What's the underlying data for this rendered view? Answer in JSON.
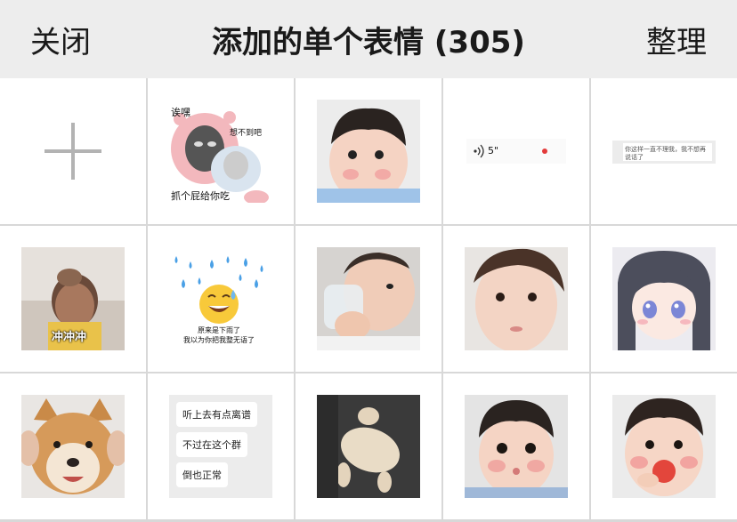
{
  "nav": {
    "close_label": "关闭",
    "title": "添加的单个表情 (305)",
    "organize_label": "整理"
  },
  "stickers": {
    "s1": {
      "top_left": "诶嘿",
      "top_right": "想不到吧",
      "bottom": "抓个屁给你吃"
    },
    "s3": {
      "audio": "5\""
    },
    "s4": {
      "text": "你这样一直不理我，我不想再说话了"
    },
    "s5": {
      "overlay": "冲冲冲"
    },
    "s6": {
      "line1": "原来是下雨了",
      "line2": "我以为你把我整无语了"
    },
    "s11": {
      "b1": "听上去有点离谱",
      "b2": "不过在这个群",
      "b3": "倒也正常"
    }
  },
  "colors": {
    "nav_bg": "#ededed",
    "divider": "#d8d8d8",
    "accent_red": "#e33b3b"
  }
}
